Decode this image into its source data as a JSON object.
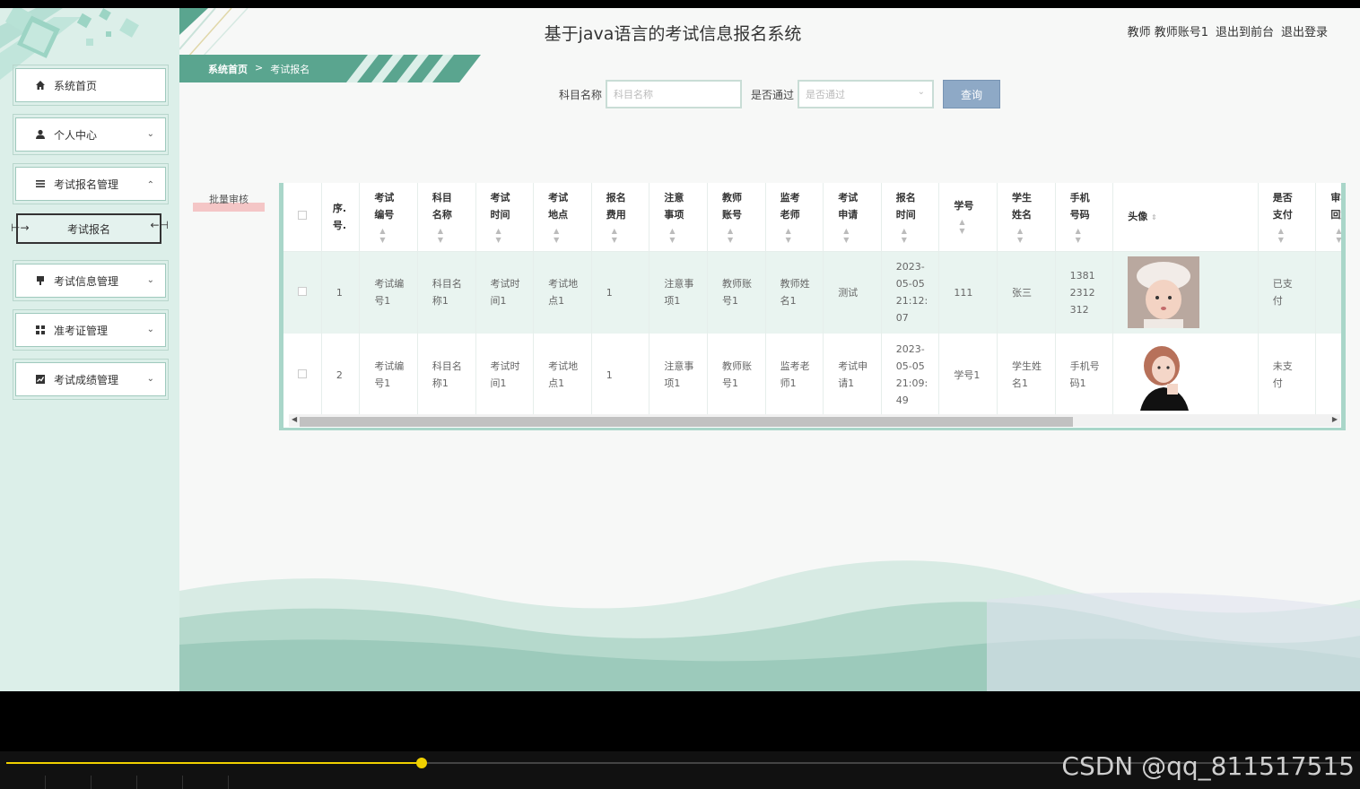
{
  "header": {
    "title": "基于java语言的考试信息报名系统",
    "user_label": "教师 教师账号1",
    "to_front": "退出到前台",
    "logout": "退出登录"
  },
  "breadcrumb": {
    "home": "系统首页",
    "separator": ">",
    "current": "考试报名"
  },
  "sidebar": {
    "items": [
      {
        "label": "系统首页",
        "icon": "home-icon"
      },
      {
        "label": "个人中心",
        "icon": "user-icon"
      },
      {
        "label": "考试报名管理",
        "icon": "list-icon"
      },
      {
        "label": "考试信息管理",
        "icon": "pin-icon"
      },
      {
        "label": "准考证管理",
        "icon": "grid-icon"
      },
      {
        "label": "考试成绩管理",
        "icon": "chart-icon"
      }
    ],
    "sub_item": "考试报名"
  },
  "search": {
    "subject_label": "科目名称",
    "subject_placeholder": "科目名称",
    "pass_label": "是否通过",
    "pass_placeholder": "是否通过",
    "query_button": "查询"
  },
  "batch_button": "批量审核",
  "table": {
    "headers": [
      "序.号.",
      "考试编号",
      "科目名称",
      "考试时间",
      "考试地点",
      "报名费用",
      "注意事项",
      "教师账号",
      "监考老师",
      "考试申请",
      "报名时间",
      "学号",
      "学生姓名",
      "手机号码",
      "头像",
      "是否支付",
      "审核回复"
    ],
    "rows": [
      [
        "1",
        "考试编号1",
        "科目名称1",
        "考试时间1",
        "考试地点1",
        "1",
        "注意事项1",
        "教师账号1",
        "教师姓名1",
        "测试",
        "2023-05-05 21:12:07",
        "111",
        "张三",
        "13812312312",
        "",
        "已支付",
        ""
      ],
      [
        "2",
        "考试编号1",
        "科目名称1",
        "考试时间1",
        "考试地点1",
        "1",
        "注意事项1",
        "教师账号1",
        "监考老师1",
        "考试申请1",
        "2023-05-05 21:09:49",
        "学号1",
        "学生姓名1",
        "手机号码1",
        "",
        "未支付",
        ""
      ]
    ]
  },
  "player": {
    "watermark": "CSDN @qq_811517515",
    "progress": 0.31
  }
}
